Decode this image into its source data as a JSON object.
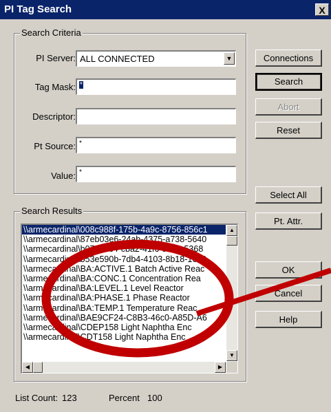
{
  "window": {
    "title": "PI Tag Search",
    "close_glyph": "X"
  },
  "criteria": {
    "legend": "Search Criteria",
    "server_label": "PI Server:",
    "server_value": "ALL CONNECTED",
    "tagmask_label": "Tag Mask:",
    "tagmask_value": "*",
    "descriptor_label": "Descriptor:",
    "descriptor_value": "",
    "ptsource_label": "Pt Source:",
    "ptsource_value": "*",
    "value_label": "Value:",
    "value_value": "*"
  },
  "buttons": {
    "connections": "Connections",
    "search": "Search",
    "abort": "Abort",
    "reset": "Reset",
    "select_all": "Select All",
    "pt_attr": "Pt. Attr.",
    "ok": "OK",
    "cancel": "Cancel",
    "help": "Help"
  },
  "results": {
    "legend": "Search Results",
    "rows": [
      "\\\\armecardinal\\008c988f-175b-4a9c-8756-856c1",
      "\\\\armecardinal\\87eb03e6-24ab-4375-a738-5640",
      "\\\\armecardinal\\b07733c4-cba2-41f6-8891-5368",
      "\\\\armecardinal\\b53e590b-7db4-4103-8b18-1649",
      "\\\\armecardinal\\BA:ACTIVE.1   Batch Active Reac",
      "\\\\armecardinal\\BA:CONC.1      Concentration Rea",
      "\\\\armecardinal\\BA:LEVEL.1     Level Reactor",
      "\\\\armecardinal\\BA:PHASE.1     Phase Reactor",
      "\\\\armecardinal\\BA:TEMP.1      Temperature Reac",
      "\\\\armecardinal\\BAE9CF24-C8B3-46c0-A85D-A6",
      "\\\\armecardinal\\CDEP158       Light Naphtha Enc",
      "\\\\armecardinal\\CDT158        Light Naphtha Enc"
    ]
  },
  "status": {
    "list_count_label": "List Count:",
    "list_count": "123",
    "percent_label": "Percent",
    "percent": "100"
  },
  "annotation": {
    "color": "#c00000"
  },
  "icons": [
    "dropdown-arrow-icon",
    "scroll-up-icon",
    "scroll-down-icon",
    "scroll-left-icon",
    "scroll-right-icon",
    "close-icon"
  ]
}
